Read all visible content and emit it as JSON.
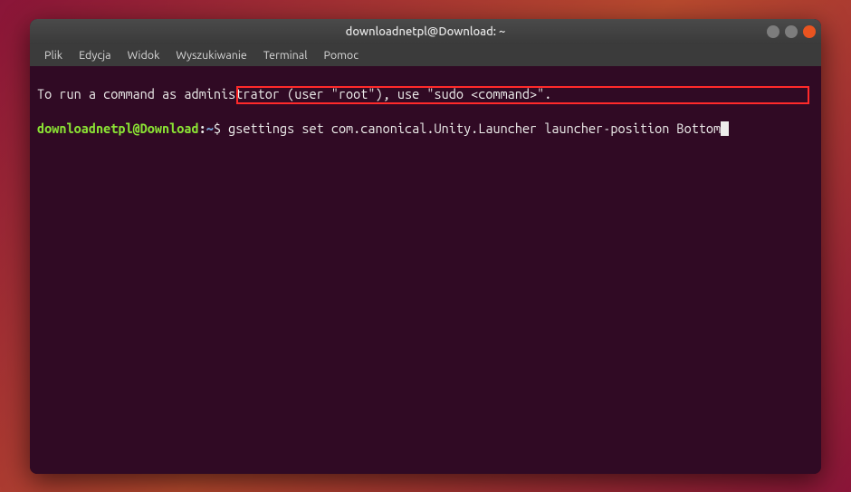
{
  "window": {
    "title": "downloadnetpl@Download: ~"
  },
  "menubar": {
    "items": [
      {
        "label": "Plik"
      },
      {
        "label": "Edycja"
      },
      {
        "label": "Widok"
      },
      {
        "label": "Wyszukiwanie"
      },
      {
        "label": "Terminal"
      },
      {
        "label": "Pomoc"
      }
    ]
  },
  "terminal": {
    "line1": "To run a command as administrator (user \"root\"), use \"sudo <command>\".",
    "prompt": {
      "user_host": "downloadnetpl@Download",
      "sep": ":",
      "path": "~",
      "symbol": "$"
    },
    "command": "gsettings set com.canonical.Unity.Launcher launcher-position Bottom"
  }
}
